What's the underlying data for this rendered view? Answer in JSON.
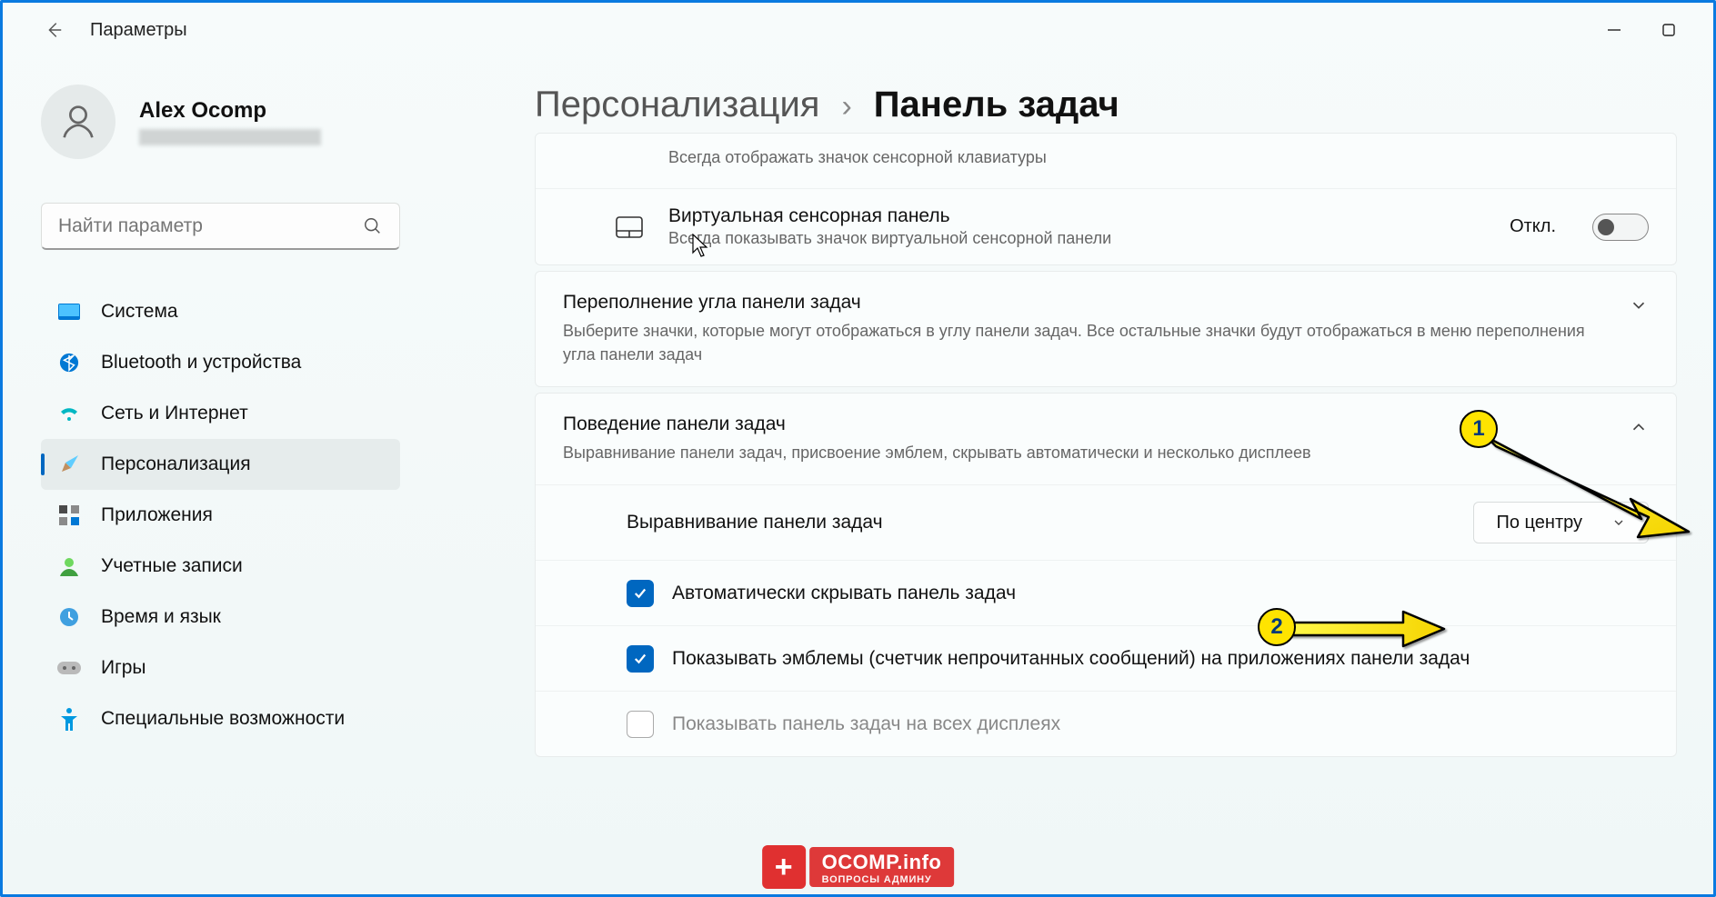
{
  "window": {
    "title": "Параметры"
  },
  "user": {
    "name": "Alex Ocomp"
  },
  "search": {
    "placeholder": "Найти параметр"
  },
  "nav": {
    "items": [
      {
        "label": "Система"
      },
      {
        "label": "Bluetooth и устройства"
      },
      {
        "label": "Сеть и Интернет"
      },
      {
        "label": "Персонализация"
      },
      {
        "label": "Приложения"
      },
      {
        "label": "Учетные записи"
      },
      {
        "label": "Время и язык"
      },
      {
        "label": "Игры"
      },
      {
        "label": "Специальные возможности"
      }
    ]
  },
  "breadcrumb": {
    "parent": "Персонализация",
    "sep": "›",
    "current": "Панель задач"
  },
  "rows": {
    "touchkb_sub": "Всегда отображать значок сенсорной клавиатуры",
    "touchpad_title": "Виртуальная сенсорная панель",
    "touchpad_sub": "Всегда показывать значок виртуальной сенсорной панели",
    "touchpad_state": "Откл."
  },
  "expanders": {
    "overflow_title": "Переполнение угла панели задач",
    "overflow_sub": "Выберите значки, которые могут отображаться в углу панели задач. Все остальные значки будут отображаться в меню переполнения угла панели задач",
    "behavior_title": "Поведение панели задач",
    "behavior_sub": "Выравнивание панели задач, присвоение эмблем, скрывать автоматически и несколько дисплеев"
  },
  "behavior": {
    "align_label": "Выравнивание панели задач",
    "align_value": "По центру",
    "cb1": "Автоматически скрывать панель задач",
    "cb2": "Показывать эмблемы (счетчик непрочитанных сообщений) на приложениях панели задач",
    "cb3": "Показывать панель задач на всех дисплеях"
  },
  "annotations": {
    "b1": "1",
    "b2": "2"
  },
  "watermark": {
    "line1": "OCOMP.info",
    "line2": "ВОПРОСЫ АДМИНУ"
  }
}
